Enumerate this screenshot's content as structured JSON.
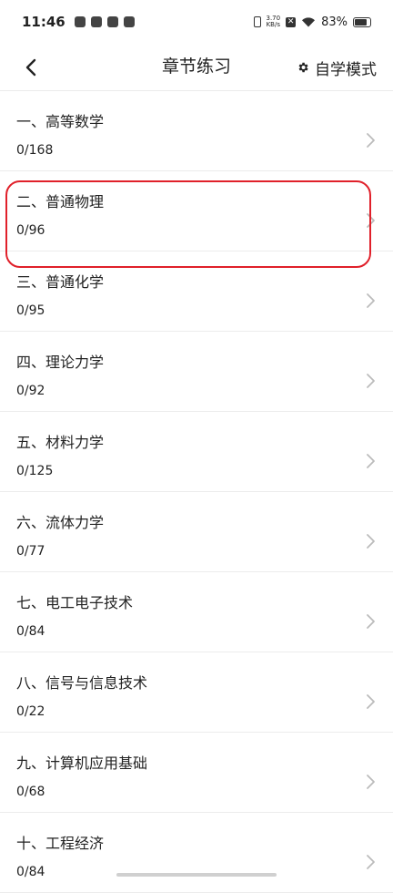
{
  "status_bar": {
    "time": "11:46",
    "net_speed_value": "3.70",
    "net_speed_unit": "KB/s",
    "battery": "83%"
  },
  "header": {
    "title": "章节练习",
    "mode_label": "自学模式"
  },
  "chapters": [
    {
      "title": "一、高等数学",
      "progress": "0/168"
    },
    {
      "title": "二、普通物理",
      "progress": "0/96"
    },
    {
      "title": "三、普通化学",
      "progress": "0/95"
    },
    {
      "title": "四、理论力学",
      "progress": "0/92"
    },
    {
      "title": "五、材料力学",
      "progress": "0/125"
    },
    {
      "title": "六、流体力学",
      "progress": "0/77"
    },
    {
      "title": "七、电工电子技术",
      "progress": "0/84"
    },
    {
      "title": "八、信号与信息技术",
      "progress": "0/22"
    },
    {
      "title": "九、计算机应用基础",
      "progress": "0/68"
    },
    {
      "title": "十、工程经济",
      "progress": "0/84"
    }
  ],
  "colors": {
    "highlight": "#e0202a",
    "divider": "#ececec",
    "chevron": "#bbbbbb"
  }
}
